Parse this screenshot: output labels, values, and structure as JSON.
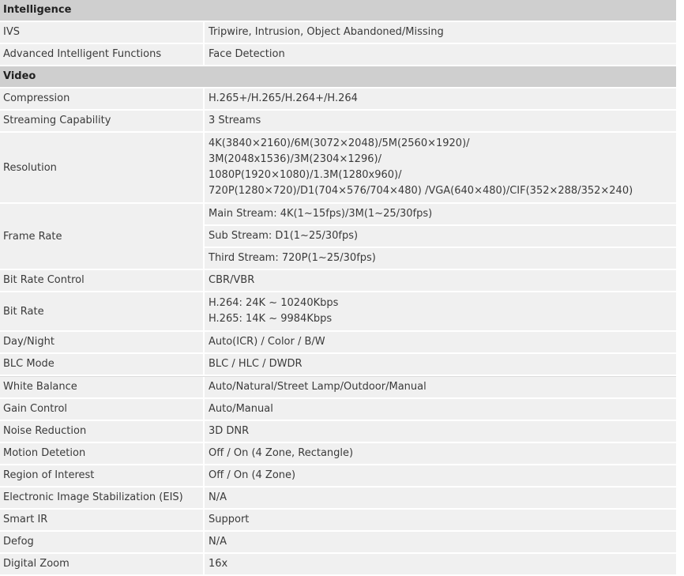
{
  "sections": [
    {
      "title": "Intelligence",
      "rows": [
        {
          "label": "IVS",
          "values": [
            "Tripwire, Intrusion, Object Abandoned/Missing"
          ]
        },
        {
          "label": "Advanced Intelligent Functions",
          "values": [
            "Face Detection"
          ]
        }
      ]
    },
    {
      "title": "Video",
      "rows": [
        {
          "label": "Compression",
          "values": [
            "H.265+/H.265/H.264+/H.264"
          ]
        },
        {
          "label": "Streaming Capability",
          "values": [
            "3 Streams"
          ]
        },
        {
          "label": "Resolution",
          "lines": [
            "4K(3840×2160)/6M(3072×2048)/5M(2560×1920)/",
            "3M(2048x1536)/3M(2304×1296)/",
            "1080P(1920×1080)/1.3M(1280x960)/",
            "720P(1280×720)/D1(704×576/704×480) /VGA(640×480)/CIF(352×288/352×240)"
          ]
        },
        {
          "label": "Frame Rate",
          "subs": [
            "Main Stream: 4K(1~15fps)/3M(1~25/30fps)",
            "Sub Stream: D1(1~25/30fps)",
            "Third Stream: 720P(1~25/30fps)"
          ]
        },
        {
          "label": "Bit Rate Control",
          "values": [
            "CBR/VBR"
          ]
        },
        {
          "label": "Bit Rate",
          "lines": [
            "H.264: 24K ~ 10240Kbps",
            "H.265: 14K ~ 9984Kbps"
          ]
        },
        {
          "label": "Day/Night",
          "values": [
            "Auto(ICR) / Color / B/W"
          ]
        },
        {
          "label": "BLC Mode",
          "values": [
            "BLC / HLC / DWDR"
          ]
        },
        {
          "label": "White Balance",
          "values": [
            "Auto/Natural/Street Lamp/Outdoor/Manual"
          ]
        },
        {
          "label": "Gain Control",
          "values": [
            "Auto/Manual"
          ]
        },
        {
          "label": "Noise Reduction",
          "values": [
            "3D DNR"
          ]
        },
        {
          "label": "Motion Detetion",
          "values": [
            "Off / On (4 Zone, Rectangle)"
          ]
        },
        {
          "label": "Region of Interest",
          "values": [
            "Off / On (4 Zone)"
          ]
        },
        {
          "label": "Electronic Image Stabilization (EIS)",
          "values": [
            "N/A"
          ]
        },
        {
          "label": "Smart IR",
          "values": [
            "Support"
          ]
        },
        {
          "label": "Defog",
          "values": [
            "N/A"
          ]
        },
        {
          "label": "Digital Zoom",
          "values": [
            "16x"
          ]
        }
      ]
    }
  ]
}
